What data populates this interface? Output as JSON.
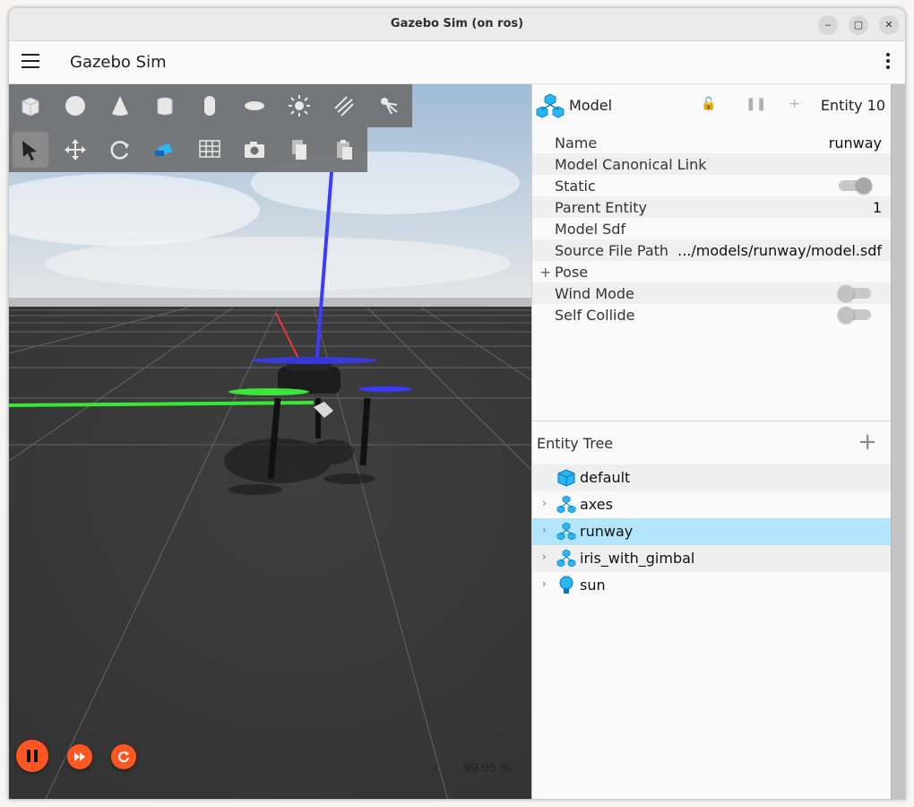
{
  "window": {
    "title": "Gazebo Sim (on ros)",
    "minimize_glyph": "‒",
    "maximize_glyph": "▢",
    "close_glyph": "✕"
  },
  "appbar": {
    "title": "Gazebo Sim",
    "menu_icon": "hamburger-icon",
    "more_icon": "kebab-menu-icon"
  },
  "toolbar": {
    "shapes": [
      "box-icon",
      "sphere-icon",
      "cone-icon",
      "cylinder-icon",
      "capsule-icon",
      "ellipsoid-icon",
      "sun-light-icon",
      "directional-light-icon",
      "spot-light-icon"
    ],
    "transform": [
      "select-arrow-icon",
      "translate-icon",
      "rotate-icon",
      "snap-icon",
      "grid-icon",
      "screenshot-camera-icon",
      "copy-icon",
      "paste-icon"
    ]
  },
  "sim_controls": {
    "play_pause_icon": "pause-icon",
    "step_icon": "fast-forward-icon",
    "reset_icon": "reset-icon",
    "rtf_arrow": "‹",
    "rtf_value": "99.05 %"
  },
  "component_inspector": {
    "model_label": "Model",
    "entity_label": "Entity 10",
    "rows": [
      {
        "key": "Name",
        "value": "runway"
      },
      {
        "key": "Model Canonical Link",
        "value": ""
      },
      {
        "key": "Static",
        "toggle": true
      },
      {
        "key": "Parent Entity",
        "value": "1"
      },
      {
        "key": "Model Sdf",
        "value": ""
      },
      {
        "key": "Source File Path",
        "value": ".../models/runway/model.sdf"
      },
      {
        "key": "Pose",
        "expand": "+"
      },
      {
        "key": "Wind Mode",
        "toggle": false
      },
      {
        "key": "Self Collide",
        "toggle": false
      }
    ]
  },
  "entity_tree": {
    "title": "Entity Tree",
    "add_glyph": "+",
    "items": [
      {
        "label": "default",
        "icon": "world-cube-icon",
        "expandable": false,
        "selected": false
      },
      {
        "label": "axes",
        "icon": "model-icon",
        "expandable": true,
        "selected": false
      },
      {
        "label": "runway",
        "icon": "model-icon",
        "expandable": true,
        "selected": true
      },
      {
        "label": "iris_with_gimbal",
        "icon": "model-icon",
        "expandable": true,
        "selected": false
      },
      {
        "label": "sun",
        "icon": "light-bulb-icon",
        "expandable": true,
        "selected": false
      }
    ]
  },
  "colors": {
    "accent": "#ff5722",
    "selection": "#b3e5fc",
    "model_icon": "#29b6f6"
  }
}
